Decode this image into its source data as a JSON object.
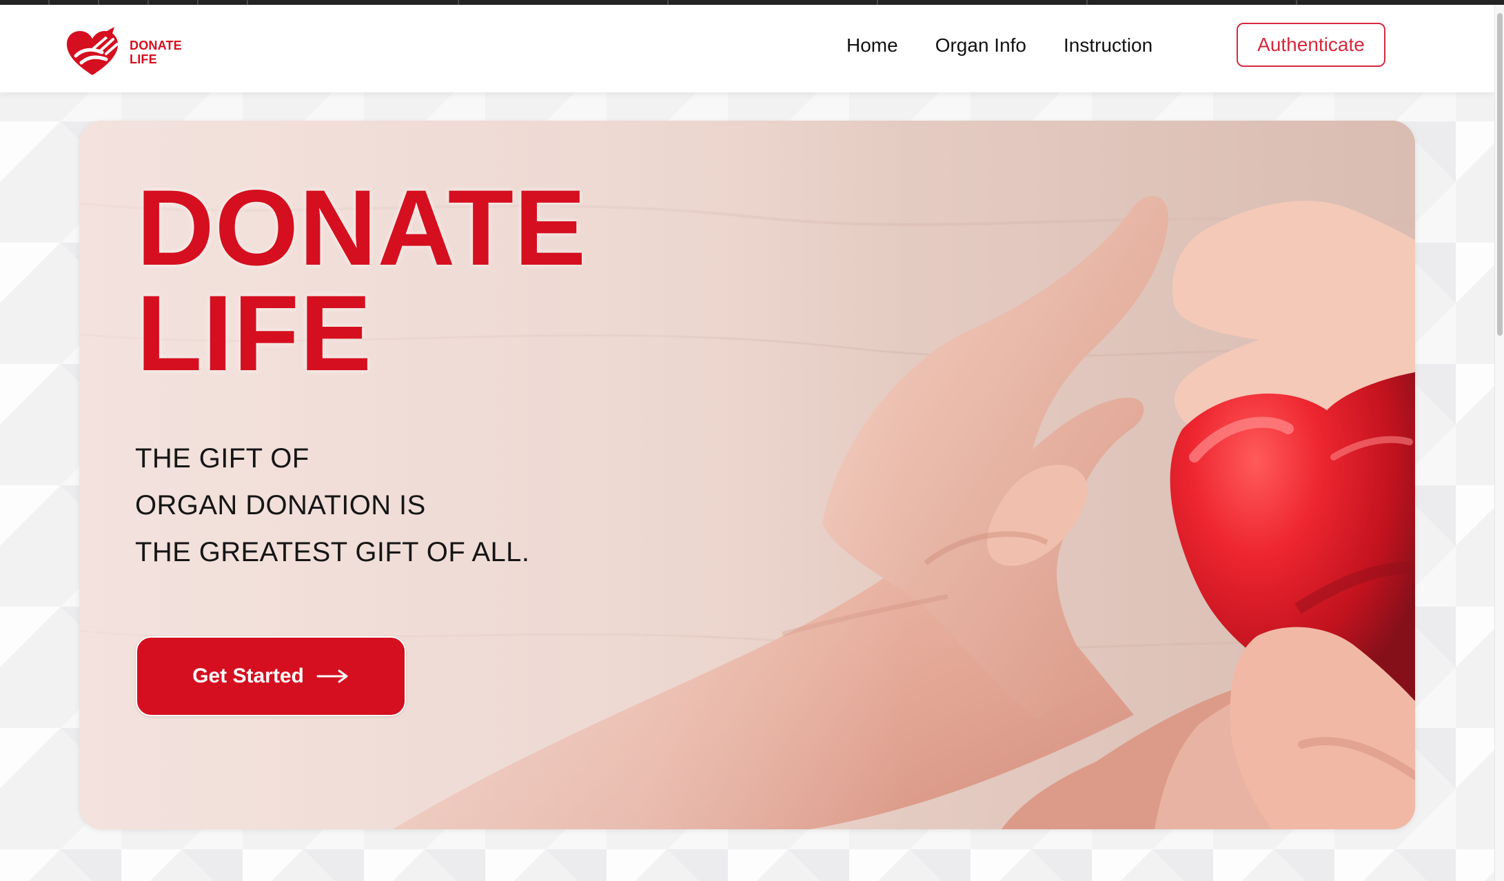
{
  "brand": {
    "line1": "DONATE",
    "line2": "LIFE",
    "logo_icon": "heart-hands-logo-icon",
    "color": "#d50f1f"
  },
  "navigation": {
    "items": [
      {
        "label": "Home"
      },
      {
        "label": "Organ Info"
      },
      {
        "label": "Instruction"
      }
    ],
    "auth_button": "Authenticate"
  },
  "hero": {
    "title_line1": "DONATE",
    "title_line2": "LIFE",
    "tagline": [
      "THE GIFT OF",
      "ORGAN DONATION IS",
      "THE GREATEST GIFT OF ALL."
    ],
    "cta_label": "Get Started",
    "cta_icon": "arrow-right-icon",
    "image_icon": "hands-holding-red-heart-illustration"
  },
  "colors": {
    "accent": "#d50f1f",
    "auth_border": "#d6293c",
    "text_dark": "#151515"
  }
}
